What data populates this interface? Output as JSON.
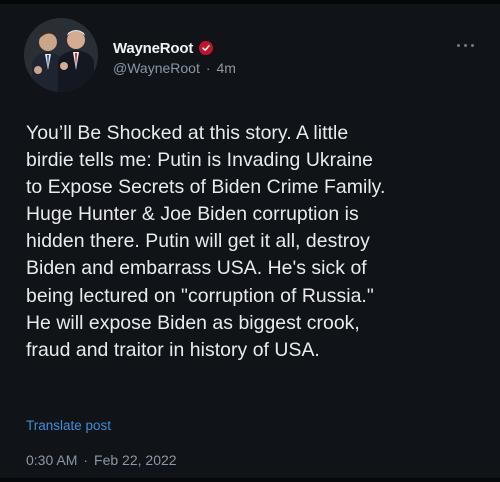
{
  "tweet": {
    "author": {
      "display_name": "WayneRoot",
      "handle": "@WayneRoot",
      "relative_time": "4m",
      "verified_badge_color": "#c8102e"
    },
    "text_lines": [
      "You’ll Be Shocked at this story. A little",
      "birdie tells me: Putin is Invading Ukraine",
      "to Expose Secrets of Biden Crime Family.",
      "Huge Hunter & Joe Biden corruption is",
      "hidden there. Putin will get it all, destroy",
      "Biden and embarrass USA. He's sick of",
      "being lectured on \"corruption of Russia.\"",
      "He will expose Biden as biggest crook,",
      "fraud and traitor in history of USA."
    ],
    "translate_label": "Translate post",
    "timestamp_time": "0:30 AM",
    "timestamp_date": "Feb 22, 2022",
    "separator": "·"
  },
  "icons": {
    "more": "more-options-icon",
    "verified": "verified-badge-icon"
  }
}
